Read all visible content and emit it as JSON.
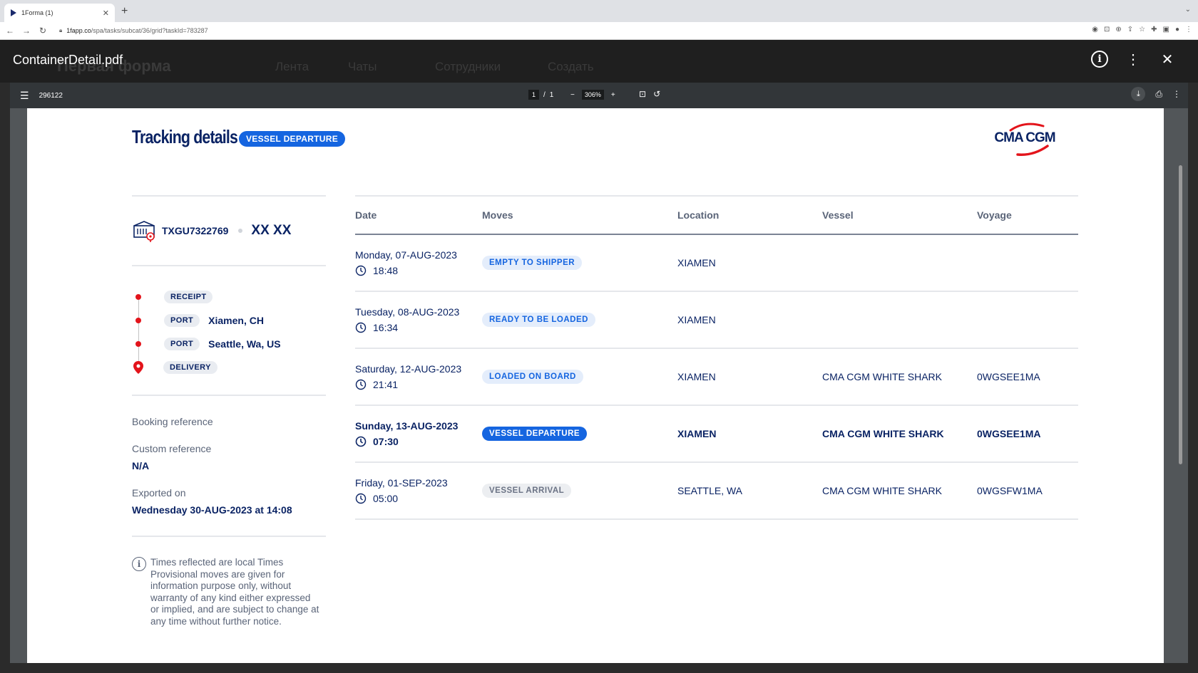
{
  "browser": {
    "tab_title": "1Forma (1)",
    "url_host": "1fapp.co",
    "url_path": "/spa/tasks/subcat/36/grid?taskId=783287"
  },
  "app": {
    "logo": "Первая форма",
    "nav": [
      "Лента",
      "Чаты",
      "Сотрудники",
      "Создать"
    ]
  },
  "viewer": {
    "file_name": "ContainerDetail.pdf",
    "doc_name": "296122",
    "page_current": "1",
    "page_total": "1",
    "zoom": "306%"
  },
  "document": {
    "title": "Tracking details",
    "status_badge": "VESSEL DEPARTURE",
    "brand": "CMA CGM",
    "container_id": "TXGU7322769",
    "container_type": "XX XX",
    "route": [
      {
        "tag": "RECEIPT",
        "place": ""
      },
      {
        "tag": "PORT",
        "place": "Xiamen, CH"
      },
      {
        "tag": "PORT",
        "place": "Seattle, Wa, US"
      },
      {
        "tag": "DELIVERY",
        "place": ""
      }
    ],
    "booking_label": "Booking reference",
    "custom_label": "Custom reference",
    "custom_value": "N/A",
    "exported_label": "Exported on",
    "exported_value": "Wednesday 30-AUG-2023 at 14:08",
    "notice": "Times reflected are local Times Provisional moves are given for information purpose only, without warranty of any kind either expressed or implied, and are subject to change at any time without further notice.",
    "table": {
      "headers": [
        "Date",
        "Moves",
        "Location",
        "Vessel",
        "Voyage"
      ],
      "rows": [
        {
          "date": "Monday, 07-AUG-2023",
          "time": "18:48",
          "move": "EMPTY TO SHIPPER",
          "location": "XIAMEN",
          "vessel": "",
          "voyage": ""
        },
        {
          "date": "Tuesday, 08-AUG-2023",
          "time": "16:34",
          "move": "READY TO BE LOADED",
          "location": "XIAMEN",
          "vessel": "",
          "voyage": ""
        },
        {
          "date": "Saturday, 12-AUG-2023",
          "time": "21:41",
          "move": "LOADED ON BOARD",
          "location": "XIAMEN",
          "vessel": "CMA CGM WHITE SHARK",
          "voyage": "0WGSEE1MA"
        },
        {
          "date": "Sunday, 13-AUG-2023",
          "time": "07:30",
          "move": "VESSEL DEPARTURE",
          "location": "XIAMEN",
          "vessel": "CMA CGM WHITE SHARK",
          "voyage": "0WGSEE1MA"
        },
        {
          "date": "Friday, 01-SEP-2023",
          "time": "05:00",
          "move": "VESSEL ARRIVAL",
          "location": "SEATTLE, WA",
          "vessel": "CMA CGM WHITE SHARK",
          "voyage": "0WGSFW1MA"
        }
      ]
    }
  },
  "colors": {
    "navy": "#0a2364",
    "accent_blue": "#1565e0",
    "brand_red": "#e3141b"
  }
}
